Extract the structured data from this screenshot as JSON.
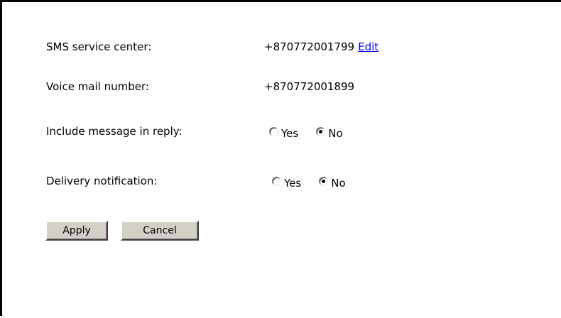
{
  "settings": {
    "sms_service_center": {
      "label": "SMS service center:",
      "value": "+870772001799",
      "edit_label": "Edit"
    },
    "voice_mail_number": {
      "label": "Voice mail number:",
      "value": "+870772001899"
    },
    "include_message_in_reply": {
      "label": "Include message in reply:",
      "options": [
        "Yes",
        "No"
      ],
      "selected": "No"
    },
    "delivery_notification": {
      "label": "Delivery notification:",
      "options": [
        "Yes",
        "No"
      ],
      "selected": "No"
    }
  },
  "actions": {
    "apply_label": "Apply",
    "cancel_label": "Cancel"
  }
}
